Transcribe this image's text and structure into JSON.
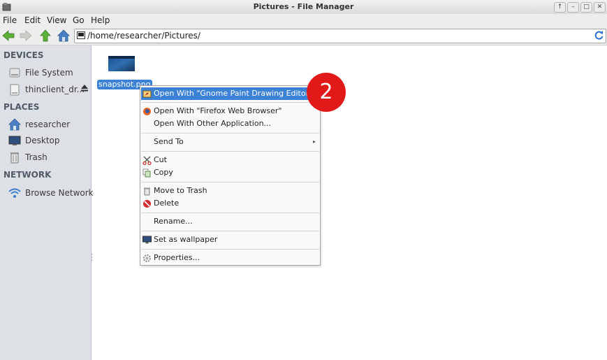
{
  "window": {
    "title": "Pictures - File Manager",
    "controls": [
      "↑",
      "–",
      "□",
      "✕"
    ]
  },
  "menubar": {
    "items": [
      "File",
      "Edit",
      "View",
      "Go",
      "Help"
    ]
  },
  "toolbar": {
    "location": "/home/researcher/Pictures/"
  },
  "sidebar": {
    "devices_header": "DEVICES",
    "devices": [
      {
        "label": "File System",
        "icon": "harddisk-icon"
      },
      {
        "label": "thinclient_dr...",
        "icon": "drive-icon"
      }
    ],
    "places_header": "PLACES",
    "places": [
      {
        "label": "researcher",
        "icon": "home-icon"
      },
      {
        "label": "Desktop",
        "icon": "desktop-icon"
      },
      {
        "label": "Trash",
        "icon": "trash-icon"
      }
    ],
    "network_header": "NETWORK",
    "network": [
      {
        "label": "Browse Network",
        "icon": "wifi-icon"
      }
    ]
  },
  "file": {
    "name": "snapshot.png"
  },
  "context_menu": {
    "open_with_default": "Open With \"Gnome Paint Drawing Editor\"",
    "open_with_firefox": "Open With \"Firefox Web Browser\"",
    "open_with_other": "Open With Other Application...",
    "send_to": "Send To",
    "cut": "Cut",
    "copy": "Copy",
    "move_to_trash": "Move to Trash",
    "delete": "Delete",
    "rename": "Rename...",
    "set_wallpaper": "Set as wallpaper",
    "properties": "Properties..."
  },
  "annotation": {
    "step": "2"
  }
}
